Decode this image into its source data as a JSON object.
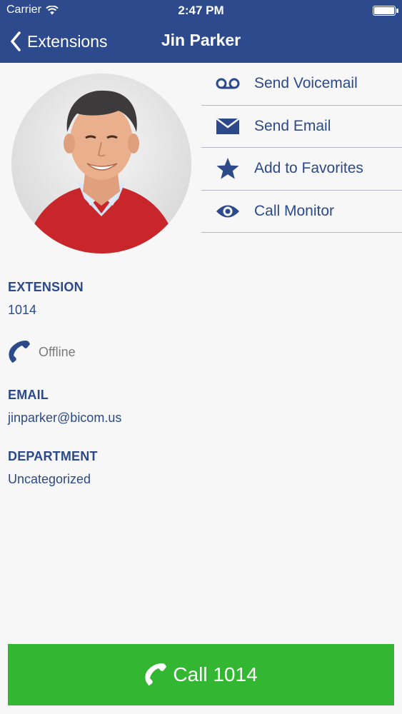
{
  "status_bar": {
    "carrier": "Carrier",
    "time": "2:47 PM"
  },
  "nav": {
    "back_label": "Extensions",
    "title": "Jin Parker"
  },
  "actions": [
    {
      "label": "Send Voicemail",
      "icon": "voicemail-icon"
    },
    {
      "label": "Send Email",
      "icon": "envelope-icon"
    },
    {
      "label": "Add to Favorites",
      "icon": "star-icon"
    },
    {
      "label": "Call Monitor",
      "icon": "eye-icon"
    }
  ],
  "details": {
    "extension_label": "EXTENSION",
    "extension_value": "1014",
    "presence_status": "Offline",
    "email_label": "EMAIL",
    "email_value": "jinparker@bicom.us",
    "department_label": "DEPARTMENT",
    "department_value": "Uncategorized"
  },
  "call_button": {
    "label": "Call 1014",
    "icon": "phone-icon"
  },
  "colors": {
    "nav_bg": "#2d4a8d",
    "accent": "#2c4a8a",
    "call_bg": "#33b733"
  }
}
